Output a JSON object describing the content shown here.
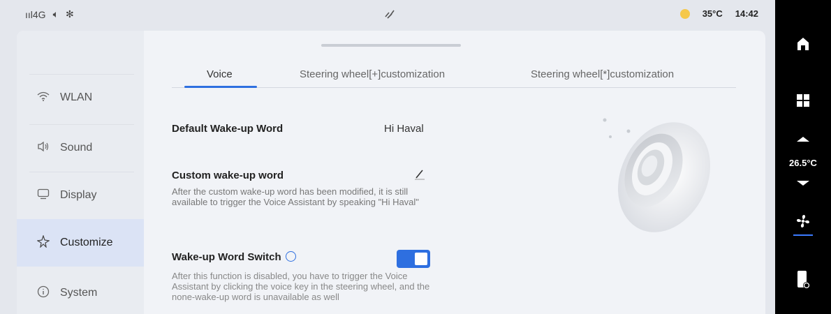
{
  "status_bar": {
    "signal": "ııl4G",
    "volume_icon": "speaker-icon",
    "bluetooth": "✻",
    "center_icon": "voice-wave-icon",
    "temperature": "35°C",
    "time": "14:42"
  },
  "sidebar": {
    "items": [
      {
        "label": "WLAN",
        "icon": "wifi-icon"
      },
      {
        "label": "Sound",
        "icon": "speaker-icon"
      },
      {
        "label": "Display",
        "icon": "monitor-icon"
      },
      {
        "label": "Customize",
        "icon": "sparkle-icon"
      },
      {
        "label": "System",
        "icon": "info-icon"
      }
    ],
    "active_index": 3
  },
  "tabs": [
    {
      "label": "Voice"
    },
    {
      "label": "Steering wheel[+]customization"
    },
    {
      "label": "Steering wheel[*]customization"
    }
  ],
  "settings": {
    "default_wake": {
      "title": "Default Wake-up Word",
      "value": "Hi Haval"
    },
    "custom_wake": {
      "title": "Custom wake-up word",
      "description": "After the custom wake-up word has been modified, it is still available to trigger the Voice Assistant by speaking \"Hi Haval\""
    },
    "wake_switch": {
      "title": "Wake-up Word Switch",
      "enabled": true,
      "description": "After this function is disabled, you have to trigger the Voice Assistant by clicking the voice key in the steering wheel, and the none-wake-up word is unavailable as well"
    }
  },
  "rail": {
    "cabin_temp": "26.5°C"
  },
  "colors": {
    "accent": "#2e6fe0",
    "active_sidebar_bg": "#dbe3f5"
  }
}
